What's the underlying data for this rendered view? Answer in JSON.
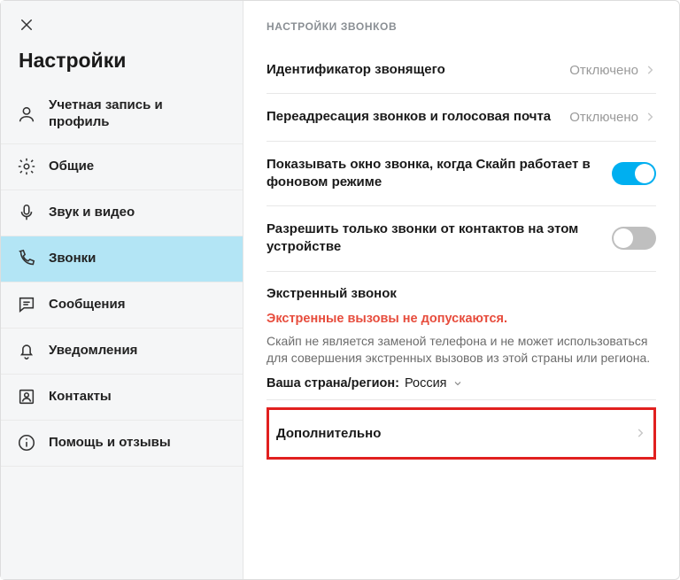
{
  "sidebar": {
    "title": "Настройки",
    "items": [
      {
        "label": "Учетная запись и профиль"
      },
      {
        "label": "Общие"
      },
      {
        "label": "Звук и видео"
      },
      {
        "label": "Звонки"
      },
      {
        "label": "Сообщения"
      },
      {
        "label": "Уведомления"
      },
      {
        "label": "Контакты"
      },
      {
        "label": "Помощь и отзывы"
      }
    ]
  },
  "main": {
    "section_title": "НАСТРОЙКИ ЗВОНКОВ",
    "caller_id": {
      "label": "Идентификатор звонящего",
      "value": "Отключено"
    },
    "forwarding": {
      "label": "Переадресация звонков и голосовая почта",
      "value": "Отключено"
    },
    "show_window": {
      "label": "Показывать окно звонка, когда Скайп работает в фоновом режиме",
      "on": true
    },
    "contacts_only": {
      "label": "Разрешить только звонки от контактов на этом устройстве",
      "on": false
    },
    "emergency": {
      "title": "Экстренный звонок",
      "warn": "Экстренные вызовы не допускаются.",
      "note": "Скайп не является заменой телефона и не может использоваться для совершения экстренных вызовов из этой страны или региона.",
      "country_label": "Ваша страна/регион:",
      "country_value": "Россия"
    },
    "advanced": {
      "label": "Дополнительно"
    }
  }
}
